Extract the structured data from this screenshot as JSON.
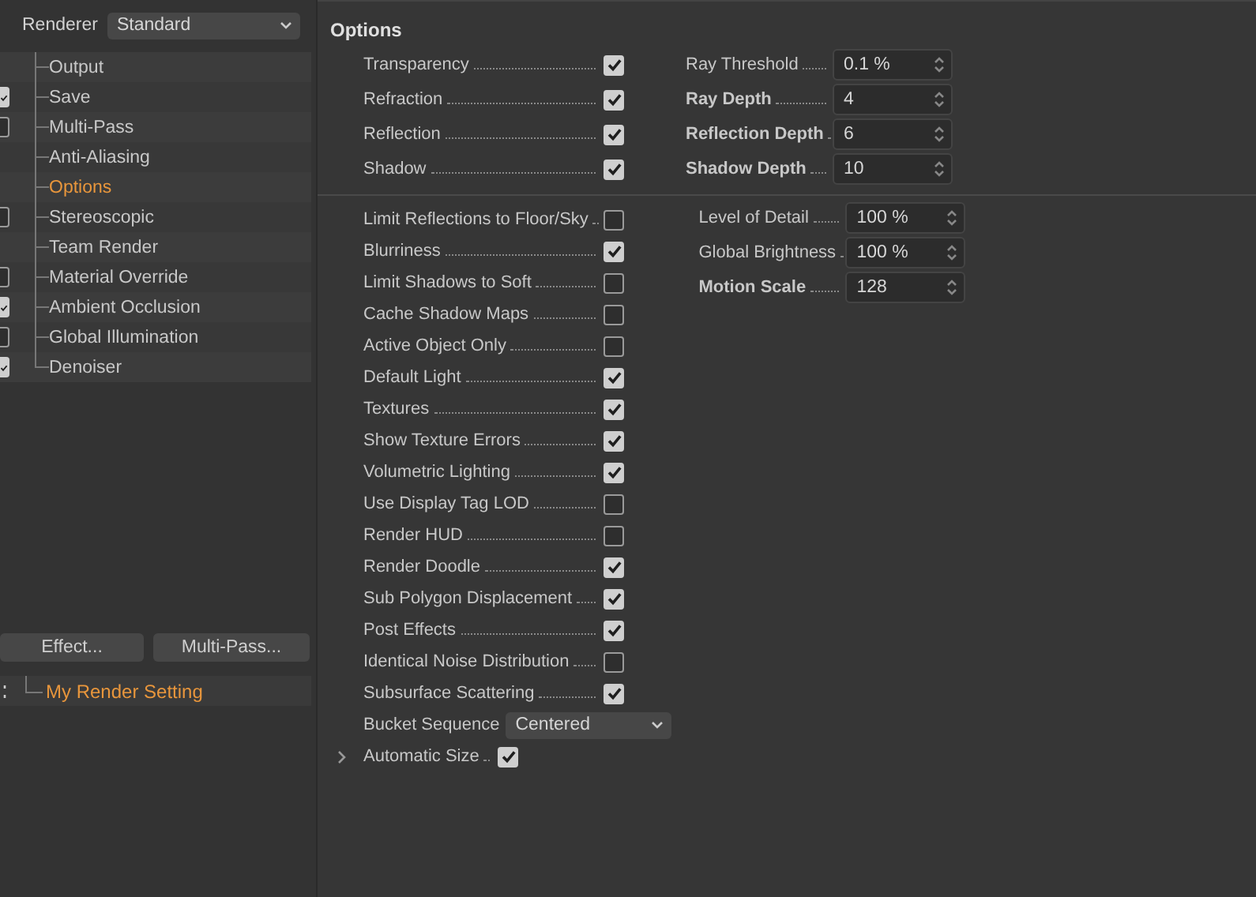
{
  "renderer": {
    "label": "Renderer",
    "value": "Standard"
  },
  "tree": [
    {
      "label": "Output",
      "kind": "plain",
      "selected": false
    },
    {
      "label": "Save",
      "kind": "toggle",
      "checked": true,
      "selected": false
    },
    {
      "label": "Multi-Pass",
      "kind": "toggle",
      "checked": false,
      "selected": false
    },
    {
      "label": "Anti-Aliasing",
      "kind": "plain",
      "selected": false
    },
    {
      "label": "Options",
      "kind": "plain",
      "selected": true
    },
    {
      "label": "Stereoscopic",
      "kind": "toggle",
      "checked": false,
      "selected": false
    },
    {
      "label": "Team Render",
      "kind": "plain",
      "selected": false
    },
    {
      "label": "Material Override",
      "kind": "toggle",
      "checked": false,
      "selected": false
    },
    {
      "label": "Ambient Occlusion",
      "kind": "toggle",
      "checked": true,
      "selected": false
    },
    {
      "label": "Global Illumination",
      "kind": "toggle",
      "checked": false,
      "selected": false
    },
    {
      "label": "Denoiser",
      "kind": "toggle",
      "checked": true,
      "selected": false
    }
  ],
  "buttons": [
    "Effect...",
    "Multi-Pass..."
  ],
  "setting": {
    "label": "My Render Setting"
  },
  "options": {
    "title": "Options",
    "group1": [
      {
        "label": "Transparency",
        "checked": true
      },
      {
        "label": "Refraction",
        "checked": true
      },
      {
        "label": "Reflection",
        "checked": true
      },
      {
        "label": "Shadow",
        "checked": true
      }
    ],
    "fields1": [
      {
        "label": "Ray Threshold",
        "value": "0.1 %",
        "bold": false
      },
      {
        "label": "Ray Depth",
        "value": "4",
        "bold": true
      },
      {
        "label": "Reflection Depth",
        "value": "6",
        "bold": true
      },
      {
        "label": "Shadow Depth",
        "value": "10",
        "bold": true
      }
    ],
    "group2": [
      {
        "kind": "check",
        "label": "Limit Reflections to Floor/Sky",
        "checked": false
      },
      {
        "kind": "check",
        "label": "Blurriness",
        "checked": true
      },
      {
        "kind": "check",
        "label": "Limit Shadows to Soft",
        "checked": false
      },
      {
        "kind": "check",
        "label": "Cache Shadow Maps",
        "checked": false
      },
      {
        "kind": "check",
        "label": "Active Object Only",
        "checked": false
      },
      {
        "kind": "check",
        "label": "Default Light",
        "checked": true
      },
      {
        "kind": "check",
        "label": "Textures",
        "checked": true
      },
      {
        "kind": "check",
        "label": "Show Texture Errors",
        "checked": true
      },
      {
        "kind": "check",
        "label": "Volumetric Lighting",
        "checked": true
      },
      {
        "kind": "check",
        "label": "Use Display Tag LOD",
        "checked": false
      },
      {
        "kind": "check",
        "label": "Render HUD",
        "checked": false
      },
      {
        "kind": "check",
        "label": "Render Doodle",
        "checked": true
      },
      {
        "kind": "check",
        "label": "Sub Polygon Displacement",
        "checked": true
      },
      {
        "kind": "check",
        "label": "Post Effects",
        "checked": true
      },
      {
        "kind": "check",
        "label": "Identical Noise Distribution",
        "checked": false
      },
      {
        "kind": "check",
        "label": "Subsurface Scattering",
        "checked": true
      },
      {
        "kind": "select",
        "label": "Bucket Sequence",
        "value": "Centered"
      },
      {
        "kind": "expander",
        "label": "Automatic Size",
        "checked": true,
        "expanded": false
      }
    ],
    "fields2": [
      {
        "label": "Level of Detail",
        "value": "100 %",
        "bold": false
      },
      {
        "label": "Global Brightness",
        "value": "100 %",
        "bold": false
      },
      {
        "label": "Motion Scale",
        "value": "128",
        "bold": true
      }
    ]
  }
}
